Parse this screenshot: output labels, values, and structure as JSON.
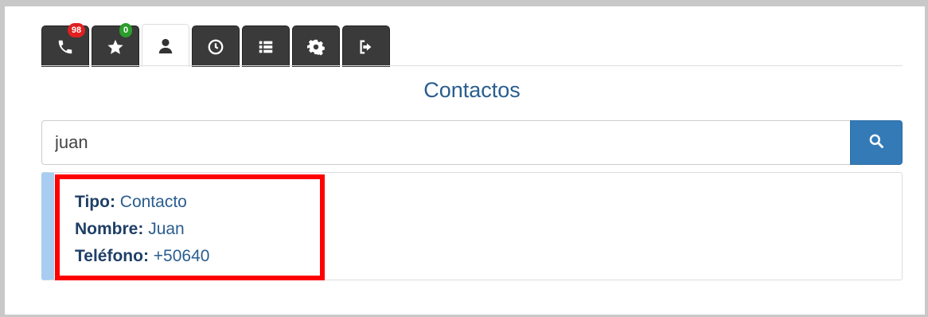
{
  "tabs": [
    {
      "id": "calls",
      "icon": "phone-icon",
      "badge": "98",
      "badge_color": "#e02020",
      "active": false
    },
    {
      "id": "favorites",
      "icon": "star-icon",
      "badge": "0",
      "badge_color": "#2a9d2a",
      "active": false
    },
    {
      "id": "contacts",
      "icon": "user-icon",
      "badge": null,
      "active": true
    },
    {
      "id": "history",
      "icon": "clock-icon",
      "badge": null,
      "active": false
    },
    {
      "id": "list",
      "icon": "list-icon",
      "badge": null,
      "active": false
    },
    {
      "id": "settings",
      "icon": "gear-icon",
      "badge": null,
      "active": false
    },
    {
      "id": "logout",
      "icon": "logout-icon",
      "badge": null,
      "active": false
    }
  ],
  "page": {
    "title": "Contactos"
  },
  "search": {
    "value": "juan",
    "button_icon": "search-icon"
  },
  "result": {
    "tipo_label": "Tipo:",
    "tipo_value": "Contacto",
    "nombre_label": "Nombre:",
    "nombre_value": "Juan",
    "telefono_label": "Teléfono:",
    "telefono_value": "+50640"
  },
  "colors": {
    "accent": "#337ab7",
    "title": "#2a5d8f",
    "highlight": "#ff0000",
    "result_bar": "#a8cdf0"
  }
}
